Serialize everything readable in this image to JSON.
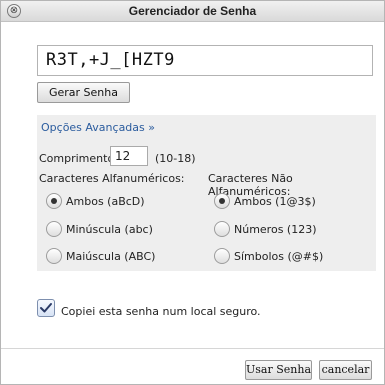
{
  "window": {
    "title": "Gerenciador de Senha",
    "close_icon": "⊗"
  },
  "password": {
    "value": "R3T,+J_[HZT9"
  },
  "generate_button": {
    "label": "Gerar Senha"
  },
  "advanced": {
    "link_label": "Opções Avançadas »",
    "length": {
      "label": "Comprimento:",
      "value": "12",
      "range": "(10-18)"
    },
    "alphanumeric": {
      "title": "Caracteres Alfanuméricos:",
      "options": [
        {
          "label": "Ambos (aBcD)",
          "checked": true
        },
        {
          "label": "Minúscula (abc)",
          "checked": false
        },
        {
          "label": "Maiúscula (ABC)",
          "checked": false
        }
      ]
    },
    "non_alphanumeric": {
      "title": "Caracteres Não Alfanuméricos:",
      "options": [
        {
          "label": "Ambos (1@3$)",
          "checked": true
        },
        {
          "label": "Números (123)",
          "checked": false
        },
        {
          "label": "Símbolos (@#$)",
          "checked": false
        }
      ]
    }
  },
  "confirm": {
    "label": "Copiei esta senha num local seguro.",
    "checked": true
  },
  "footer": {
    "use_label": "Usar Senha",
    "cancel_label": "cancelar"
  }
}
